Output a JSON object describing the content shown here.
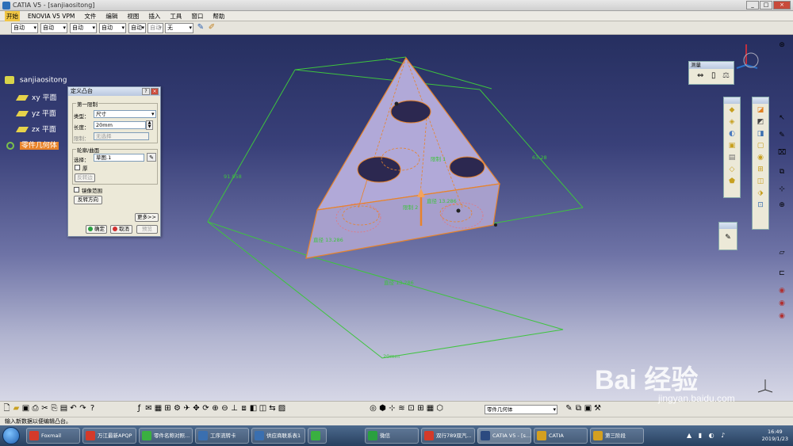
{
  "window": {
    "title": "CATIA V5 - [sanjiaositong]",
    "buttons": [
      "_",
      "□",
      "×"
    ]
  },
  "menu": [
    {
      "label": "开始",
      "active": true
    },
    {
      "label": "ENOVIA V5 VPM"
    },
    {
      "label": "文件"
    },
    {
      "label": "编辑"
    },
    {
      "label": "视图"
    },
    {
      "label": "插入"
    },
    {
      "label": "工具"
    },
    {
      "label": "窗口"
    },
    {
      "label": "帮助"
    }
  ],
  "toolbar": {
    "dd1": "自动",
    "dd2": "自动",
    "dd3": "自动",
    "dd4": "自动",
    "dd5": "自动",
    "dd6": "自动",
    "dd7": "无"
  },
  "tree": {
    "root": "sanjiaositong",
    "items": [
      "xy 平面",
      "yz 平面",
      "zx 平面"
    ],
    "body": "零件几何体"
  },
  "dialog": {
    "title": "定义凸台",
    "group1": "第一限制",
    "type_label": "类型：",
    "type_value": "尺寸",
    "length_label": "长度：",
    "length_value": "20mm",
    "limit_label": "限制：",
    "limit_value": "无选择",
    "group2": "轮廓/曲面",
    "select_label": "选择：",
    "select_value": "草图.1",
    "thick_label": "厚",
    "reverse_side": "反转边",
    "mirror_label": "镜像范围",
    "reverse_dir": "反转方向",
    "more": "更多>>",
    "ok": "确定",
    "cancel": "取消",
    "preview": "预览"
  },
  "measure_toolbar": {
    "title": "测量"
  },
  "dims": {
    "d1": "91.958",
    "d2": "63.28",
    "d3": "限制 1",
    "d4": "直径 13.286",
    "d5": "直径 13.286",
    "d6": "限制 2",
    "d7": "直径 13.286",
    "d8": "20mm"
  },
  "bottom_toolbar": {
    "body_dd": "零件几何体"
  },
  "status": "输入新数据以便编辑凸台。",
  "taskbar": {
    "items": [
      "Foxmail",
      "万江最新APQP",
      "零件名称对照...",
      "工序流转卡",
      "供应商联系表1",
      "",
      "微信",
      "双行789双汽...",
      "CATIA V5 - [s...",
      "CATIA",
      "第三阶段"
    ],
    "time": "16:49",
    "date": "2019/1/23"
  },
  "watermark": {
    "brand": "Bai 经验",
    "url": "jingyan.baidu.com"
  },
  "colors": {
    "accent": "#e8832a",
    "dim_green": "#3ec43e",
    "part_face": "#b1a9d8",
    "part_edge": "#e8832a"
  }
}
